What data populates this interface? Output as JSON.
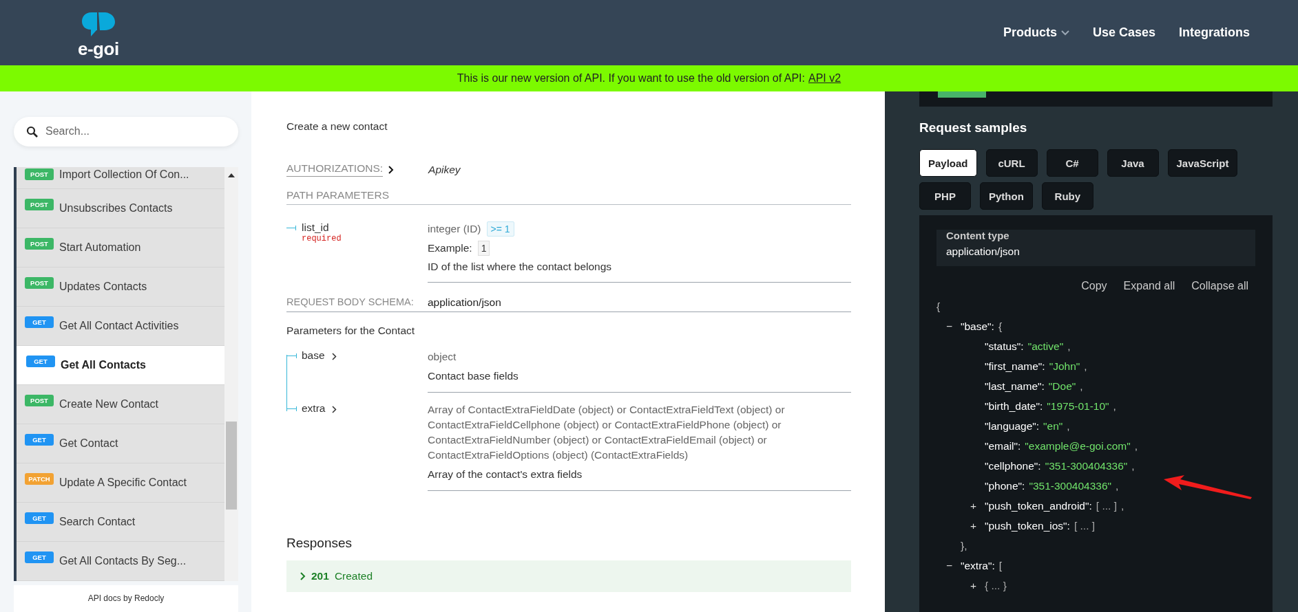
{
  "header": {
    "logo": "e-goi",
    "nav": [
      {
        "label": "Products",
        "dropdown": true
      },
      {
        "label": "Use Cases",
        "dropdown": false
      },
      {
        "label": "Integrations",
        "dropdown": false
      }
    ]
  },
  "banner": {
    "text": "This is our new version of API. If you want to use the old version of API:",
    "link": "API v2"
  },
  "sidebar": {
    "search": {
      "placeholder": "Search..."
    },
    "items": [
      {
        "method": "POST",
        "label": "Import Collection Of Con...",
        "selected": false
      },
      {
        "method": "POST",
        "label": "Unsubscribes Contacts",
        "selected": false
      },
      {
        "method": "POST",
        "label": "Start Automation",
        "selected": false
      },
      {
        "method": "POST",
        "label": "Updates Contacts",
        "selected": false
      },
      {
        "method": "GET",
        "label": "Get All Contact Activities",
        "selected": false
      },
      {
        "method": "GET",
        "label": "Get All Contacts",
        "selected": true
      },
      {
        "method": "POST",
        "label": "Create New Contact",
        "selected": false
      },
      {
        "method": "GET",
        "label": "Get Contact",
        "selected": false
      },
      {
        "method": "PATCH",
        "label": "Update A Specific Contact",
        "selected": false
      },
      {
        "method": "GET",
        "label": "Search Contact",
        "selected": false
      },
      {
        "method": "GET",
        "label": "Get All Contacts By Seg...",
        "selected": false
      }
    ],
    "footer": "API docs by Redocly"
  },
  "main": {
    "description": "Create a new contact",
    "authorizations": {
      "label": "AUTHORIZATIONS:",
      "value": "Apikey"
    },
    "path_parameters": {
      "heading": "PATH PARAMETERS",
      "params": [
        {
          "name": "list_id",
          "required": "required",
          "type": "integer (ID)",
          "constraint": ">= 1",
          "example_label": "Example:",
          "example": "1",
          "description": "ID of the list where the contact belongs"
        }
      ]
    },
    "request_body": {
      "label": "REQUEST BODY SCHEMA:",
      "value": "application/json",
      "description": "Parameters for the Contact",
      "params": [
        {
          "name": "base",
          "type": "object",
          "description": "Contact base fields"
        },
        {
          "name": "extra",
          "type": "Array of ContactExtraFieldDate (object) or ContactExtraFieldText (object) or ContactExtraFieldCellphone (object) or ContactExtraFieldPhone (object) or ContactExtraFieldNumber (object) or ContactExtraFieldEmail (object) or ContactExtraFieldOptions (object) (ContactExtraFields)",
          "description": "Array of the contact's extra fields"
        }
      ]
    },
    "responses": {
      "heading": "Responses",
      "items": [
        {
          "code": "201",
          "text": "Created"
        }
      ]
    }
  },
  "samples": {
    "title": "Request samples",
    "tabs": [
      {
        "label": "Payload",
        "selected": true
      },
      {
        "label": "cURL",
        "selected": false
      },
      {
        "label": "C#",
        "selected": false
      },
      {
        "label": "Java",
        "selected": false
      },
      {
        "label": "JavaScript",
        "selected": false
      },
      {
        "label": "PHP",
        "selected": false
      },
      {
        "label": "Python",
        "selected": false
      },
      {
        "label": "Ruby",
        "selected": false
      }
    ],
    "content_type": {
      "label": "Content type",
      "value": "application/json"
    },
    "actions": [
      "Copy",
      "Expand all",
      "Collapse all"
    ],
    "code": {
      "open": "{",
      "children": [
        {
          "toggle": "−",
          "key": "\"base\":",
          "open": "{",
          "close": "},",
          "children": [
            {
              "key": "\"status\":",
              "value": "\"active\"",
              "kind": "string",
              "suffix": ","
            },
            {
              "key": "\"first_name\":",
              "value": "\"John\"",
              "kind": "string",
              "suffix": ","
            },
            {
              "key": "\"last_name\":",
              "value": "\"Doe\"",
              "kind": "string",
              "suffix": ","
            },
            {
              "key": "\"birth_date\":",
              "value": "\"1975-01-10\"",
              "kind": "string",
              "suffix": ","
            },
            {
              "key": "\"language\":",
              "value": "\"en\"",
              "kind": "string",
              "suffix": ","
            },
            {
              "key": "\"email\":",
              "value": "\"example@e-goi.com\"",
              "kind": "string",
              "suffix": ","
            },
            {
              "key": "\"cellphone\":",
              "value": "\"351-300404336\"",
              "kind": "string",
              "suffix": ","
            },
            {
              "key": "\"phone\":",
              "value": "\"351-300404336\"",
              "kind": "string",
              "suffix": ","
            },
            {
              "toggle": "+",
              "key": "\"push_token_android\":",
              "value": "[ ... ]",
              "kind": "collapsed",
              "suffix": ","
            },
            {
              "toggle": "+",
              "key": "\"push_token_ios\":",
              "value": "[ ... ]",
              "kind": "collapsed"
            }
          ]
        },
        {
          "toggle": "−",
          "key": "\"extra\":",
          "open": "[",
          "children": [
            {
              "toggle": "+",
              "value": "{ ... }",
              "kind": "collapsed"
            }
          ]
        }
      ]
    }
  }
}
